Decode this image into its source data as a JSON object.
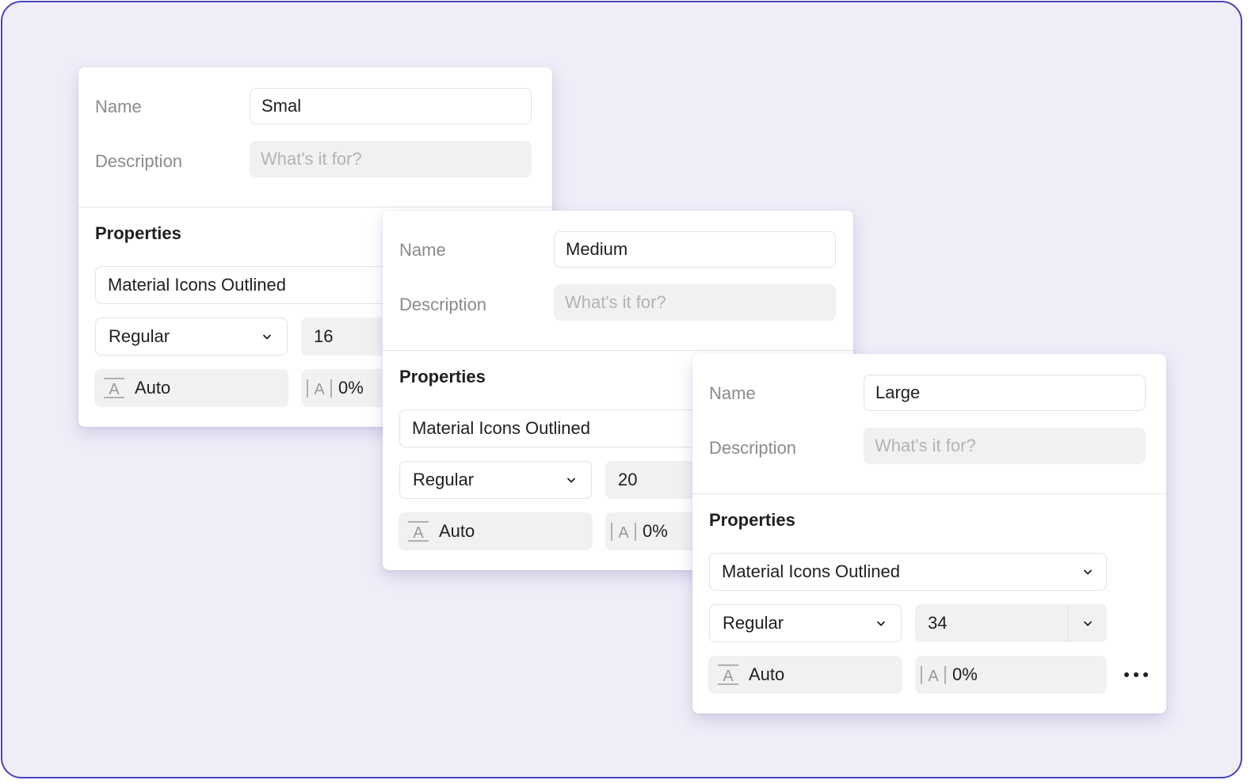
{
  "cards": [
    {
      "name_label": "Name",
      "name_value": "Smal",
      "description_label": "Description",
      "description_placeholder": "What's it for?",
      "properties_title": "Properties",
      "font_family": "Material Icons Outlined",
      "font_weight": "Regular",
      "font_size": "16",
      "line_height": "Auto",
      "letter_spacing": "0%"
    },
    {
      "name_label": "Name",
      "name_value": "Medium",
      "description_label": "Description",
      "description_placeholder": "What's it for?",
      "properties_title": "Properties",
      "font_family": "Material Icons Outlined",
      "font_weight": "Regular",
      "font_size": "20",
      "line_height": "Auto",
      "letter_spacing": "0%"
    },
    {
      "name_label": "Name",
      "name_value": "Large",
      "description_label": "Description",
      "description_placeholder": "What's it for?",
      "properties_title": "Properties",
      "font_family": "Material Icons Outlined",
      "font_weight": "Regular",
      "font_size": "34",
      "line_height": "Auto",
      "letter_spacing": "0%"
    }
  ],
  "icons": {
    "chevron": "chevron-down-icon",
    "line_height": "line-height-icon",
    "letter_spacing": "letter-spacing-icon",
    "more": "more-horizontal-icon"
  },
  "colors": {
    "frame_border": "#4a43b8",
    "background": "#efedf8",
    "card": "#ffffff",
    "field_fill": "#f1f1f1",
    "label": "#8b8b8b",
    "text": "#1f1f1f"
  }
}
